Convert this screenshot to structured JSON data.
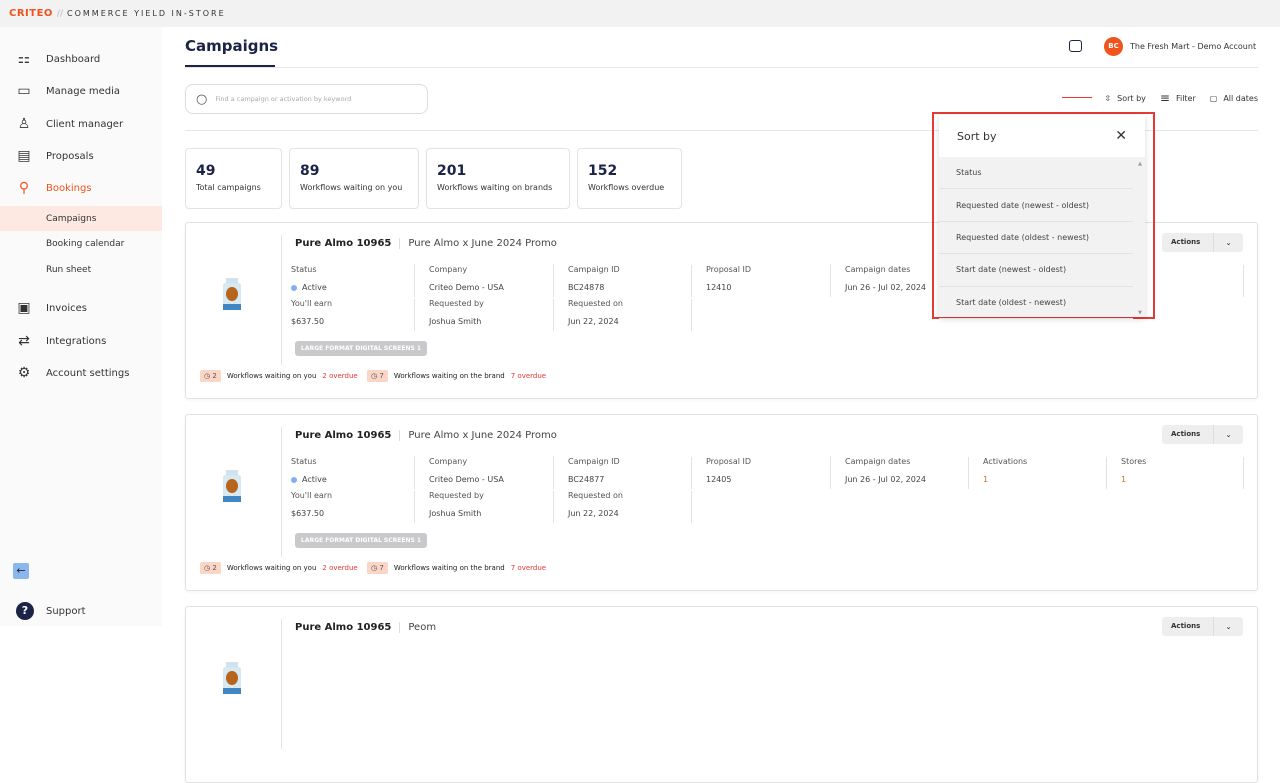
{
  "brand": {
    "logo": "CRITEO",
    "separator": "//",
    "product": "COMMERCE YIELD IN-STORE"
  },
  "sidebar": {
    "items": [
      {
        "label": "Dashboard",
        "icon": "dashboard-icon"
      },
      {
        "label": "Manage media",
        "icon": "monitor-icon"
      },
      {
        "label": "Client manager",
        "icon": "user-icon"
      },
      {
        "label": "Proposals",
        "icon": "calendar-icon"
      },
      {
        "label": "Bookings",
        "icon": "bookings-icon"
      }
    ],
    "sub": [
      "Campaigns",
      "Booking calendar",
      "Run sheet"
    ],
    "items2": [
      {
        "label": "Invoices"
      },
      {
        "label": "Integrations"
      },
      {
        "label": "Account settings"
      }
    ],
    "support": "Support"
  },
  "header": {
    "title": "Campaigns",
    "avatar": "BC",
    "account": "The Fresh Mart - Demo Account"
  },
  "search": {
    "placeholder": "Find a campaign or activation by keyword"
  },
  "toolbar": {
    "sort": "Sort by",
    "filter": "Filter",
    "dates": "All dates"
  },
  "stats": [
    {
      "value": "49",
      "label": "Total campaigns"
    },
    {
      "value": "89",
      "label": "Workflows waiting on you"
    },
    {
      "value": "201",
      "label": "Workflows waiting on brands"
    },
    {
      "value": "152",
      "label": "Workflows overdue"
    }
  ],
  "labels": {
    "status": "Status",
    "earn": "You'll earn",
    "company": "Company",
    "requested_by": "Requested by",
    "campaign_id": "Campaign ID",
    "requested_on": "Requested on",
    "proposal_id": "Proposal ID",
    "dates": "Campaign dates",
    "activations": "Activations",
    "stores": "Stores",
    "actions": "Actions",
    "wf_you": "Workflows waiting on you",
    "wf_brand": "Workflows waiting on the brand"
  },
  "campaigns": [
    {
      "name": "Pure Almo 10965",
      "title": "Pure Almo x June 2024 Promo",
      "status": "Active",
      "earn": "$637.50",
      "company": "Criteo Demo - USA",
      "requested_by": "Joshua Smith",
      "campaign_id": "BC24878",
      "requested_on": "Jun 22, 2024",
      "proposal_id": "12410",
      "dates": "Jun 26 - Jul 02, 2024",
      "activations": "",
      "stores": "",
      "tag": "LARGE FORMAT DIGITAL SCREENS",
      "tag_count": "1",
      "wf_you": "2",
      "wf_you_overdue": "2 overdue",
      "wf_brand": "7",
      "wf_brand_overdue": "7 overdue"
    },
    {
      "name": "Pure Almo 10965",
      "title": "Pure Almo x June 2024 Promo",
      "status": "Active",
      "earn": "$637.50",
      "company": "Criteo Demo - USA",
      "requested_by": "Joshua Smith",
      "campaign_id": "BC24877",
      "requested_on": "Jun 22, 2024",
      "proposal_id": "12405",
      "dates": "Jun 26 - Jul 02, 2024",
      "activations": "1",
      "stores": "1",
      "tag": "LARGE FORMAT DIGITAL SCREENS",
      "tag_count": "1",
      "wf_you": "2",
      "wf_you_overdue": "2 overdue",
      "wf_brand": "7",
      "wf_brand_overdue": "7 overdue"
    },
    {
      "name": "Pure Almo 10965",
      "title": "Peom",
      "actions": "Actions"
    }
  ],
  "sort_dropdown": {
    "title": "Sort by",
    "options": [
      "Status",
      "Requested date (newest - oldest)",
      "Requested date (oldest - newest)",
      "Start date (newest - oldest)",
      "Start date (oldest - newest)"
    ]
  }
}
